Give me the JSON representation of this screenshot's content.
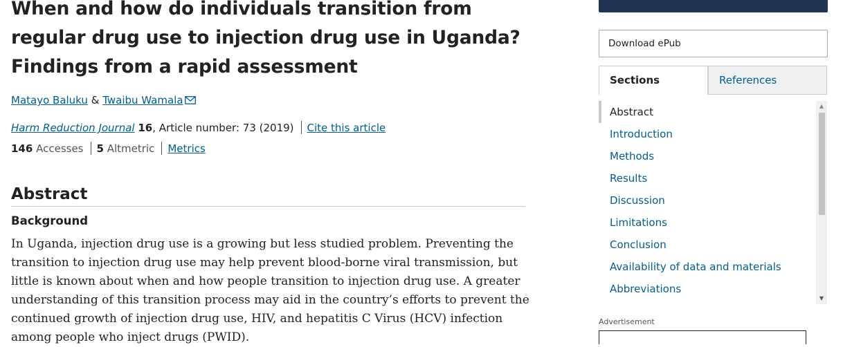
{
  "article": {
    "title": "When and how do individuals transition from regular drug use to injection drug use in Uganda? Findings from a rapid assessment",
    "authors": [
      {
        "name": "Matayo Baluku"
      },
      {
        "name": "Twaibu Wamala"
      }
    ],
    "author_separator": "&",
    "citation": {
      "journal": "Harm Reduction Journal",
      "volume": "16",
      "article_number": ", Article number: 73 (2019)",
      "cite_label": "Cite this article"
    },
    "metrics": {
      "accesses_count": "146",
      "accesses_label": "Accesses",
      "altmetric_count": "5",
      "altmetric_label": "Altmetric",
      "metrics_link": "Metrics"
    },
    "abstract": {
      "heading": "Abstract",
      "background_heading": "Background",
      "background_text": "In Uganda, injection drug use is a growing but less studied problem. Preventing the transition to injection drug use may help prevent blood-borne viral transmission, but little is known about when and how people transition to injection drug use. A greater understanding of this transition process may aid in the country’s efforts to prevent the continued growth of injection drug use, HIV, and hepatitis C Virus (HCV) infection among people who inject drugs (PWID)."
    }
  },
  "sidebar": {
    "download_epub_label": "Download ePub",
    "tabs": [
      {
        "label": "Sections",
        "active": true
      },
      {
        "label": "References",
        "active": false
      }
    ],
    "sections": [
      {
        "label": "Abstract",
        "active": true
      },
      {
        "label": "Introduction"
      },
      {
        "label": "Methods"
      },
      {
        "label": "Results"
      },
      {
        "label": "Discussion"
      },
      {
        "label": "Limitations"
      },
      {
        "label": "Conclusion"
      },
      {
        "label": "Availability of data and materials"
      },
      {
        "label": "Abbreviations"
      }
    ],
    "advertisement_label": "Advertisement"
  },
  "icons": {
    "email": "envelope-icon",
    "scroll_up": "triangle-up-icon",
    "scroll_down": "triangle-down-icon"
  },
  "colors": {
    "link": "#025e8d",
    "heading": "#222222",
    "sidebar_bar": "#1f3552",
    "tab_inactive_bg": "#eef0f2"
  }
}
